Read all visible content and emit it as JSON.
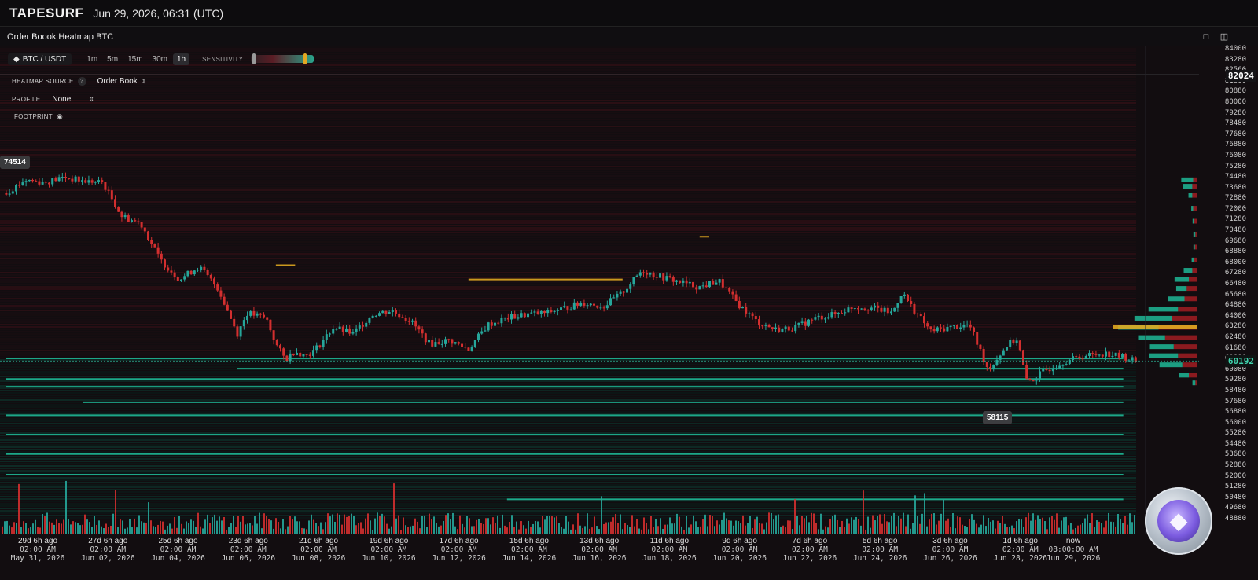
{
  "header": {
    "brand": "TAPESURF",
    "timestamp": "Jun 29, 2026, 06:31 (UTC)"
  },
  "panel": {
    "title": "Order Boook Heatmap BTC",
    "window_buttons": [
      "square-icon",
      "split-icon"
    ]
  },
  "toolbar": {
    "symbol": "BTC / USDT",
    "timeframes": [
      "1m",
      "5m",
      "15m",
      "30m",
      "1h"
    ],
    "active_timeframe": "1h",
    "sensitivity_label": "SENSITIVITY",
    "sensitivity": {
      "low": 0.02,
      "high": 0.88
    }
  },
  "options": {
    "heatmap_source_label": "HEATMAP SOURCE",
    "heatmap_source_help": "?",
    "heatmap_source_value": "Order Book",
    "profile_label": "PROFILE",
    "profile_value": "None",
    "footprint_label": "FOOTPRINT"
  },
  "markers": {
    "high": "74514",
    "low": "58115"
  },
  "colors": {
    "up": "#26a69a",
    "down": "#d32f2f",
    "bid_liquidity": "#1fb896",
    "ask_liquidity": "#8b1a1f",
    "background": "#0f0d10",
    "highlight": "#e0a820"
  },
  "chart_data": {
    "type": "candlestick",
    "title": "Order Boook Heatmap BTC",
    "interval": "1h",
    "ylim": [
      48000,
      84400
    ],
    "y_ticks": [
      "84000",
      "83280",
      "82560",
      "81600",
      "80880",
      "80000",
      "79280",
      "78480",
      "77680",
      "76880",
      "76080",
      "75280",
      "74480",
      "73680",
      "72880",
      "72000",
      "71280",
      "70480",
      "69680",
      "68880",
      "68000",
      "67280",
      "66480",
      "65680",
      "64880",
      "64000",
      "63280",
      "62480",
      "61680",
      "60880",
      "60080",
      "59280",
      "58480",
      "57680",
      "56880",
      "56000",
      "55280",
      "54480",
      "53680",
      "52880",
      "52000",
      "51280",
      "50480",
      "49680",
      "48880"
    ],
    "current_price": "60192",
    "crosshair_price": "82024",
    "x_labels": [
      {
        "rel": "29d 6h ago",
        "time": "02:00 AM",
        "date": "May 31, 2026"
      },
      {
        "rel": "27d 6h ago",
        "time": "02:00 AM",
        "date": "Jun 02, 2026"
      },
      {
        "rel": "25d 6h ago",
        "time": "02:00 AM",
        "date": "Jun 04, 2026"
      },
      {
        "rel": "23d 6h ago",
        "time": "02:00 AM",
        "date": "Jun 06, 2026"
      },
      {
        "rel": "21d 6h ago",
        "time": "02:00 AM",
        "date": "Jun 08, 2026"
      },
      {
        "rel": "19d 6h ago",
        "time": "02:00 AM",
        "date": "Jun 10, 2026"
      },
      {
        "rel": "17d 6h ago",
        "time": "02:00 AM",
        "date": "Jun 12, 2026"
      },
      {
        "rel": "15d 6h ago",
        "time": "02:00 AM",
        "date": "Jun 14, 2026"
      },
      {
        "rel": "13d 6h ago",
        "time": "02:00 AM",
        "date": "Jun 16, 2026"
      },
      {
        "rel": "11d 6h ago",
        "time": "02:00 AM",
        "date": "Jun 18, 2026"
      },
      {
        "rel": "9d 6h ago",
        "time": "02:00 AM",
        "date": "Jun 20, 2026"
      },
      {
        "rel": "7d 6h ago",
        "time": "02:00 AM",
        "date": "Jun 22, 2026"
      },
      {
        "rel": "5d 6h ago",
        "time": "02:00 AM",
        "date": "Jun 24, 2026"
      },
      {
        "rel": "3d 6h ago",
        "time": "02:00 AM",
        "date": "Jun 26, 2026"
      },
      {
        "rel": "1d 6h ago",
        "time": "02:00 AM",
        "date": "Jun 28, 2026"
      },
      {
        "rel": "now",
        "time": "08:00:00 AM",
        "date": "Jun 29, 2026"
      }
    ],
    "price_path": [
      {
        "x": "May 31, 2026",
        "y": 73200
      },
      {
        "x": "May 31, 2026 12:00",
        "y": 74200
      },
      {
        "x": "Jun 01, 2026",
        "y": 74000
      },
      {
        "x": "Jun 01, 2026 12:00",
        "y": 74400
      },
      {
        "x": "Jun 02, 2026",
        "y": 74100
      },
      {
        "x": "Jun 02, 2026 12:00",
        "y": 74000
      },
      {
        "x": "Jun 03, 2026",
        "y": 71400
      },
      {
        "x": "Jun 03, 2026 12:00",
        "y": 70800
      },
      {
        "x": "Jun 04, 2026",
        "y": 68000
      },
      {
        "x": "Jun 04, 2026 12:00",
        "y": 66500
      },
      {
        "x": "Jun 05, 2026",
        "y": 67500
      },
      {
        "x": "Jun 05, 2026 12:00",
        "y": 65800
      },
      {
        "x": "Jun 06, 2026",
        "y": 62300
      },
      {
        "x": "Jun 06, 2026 06:00",
        "y": 63900
      },
      {
        "x": "Jun 06, 2026 18:00",
        "y": 63500
      },
      {
        "x": "Jun 07, 2026",
        "y": 61500
      },
      {
        "x": "Jun 07, 2026 06:00",
        "y": 60300
      },
      {
        "x": "Jun 07, 2026 12:00",
        "y": 61000
      },
      {
        "x": "Jun 07, 2026 18:00",
        "y": 60600
      },
      {
        "x": "Jun 08, 2026",
        "y": 61000
      },
      {
        "x": "Jun 08, 2026 12:00",
        "y": 62800
      },
      {
        "x": "Jun 09, 2026",
        "y": 62300
      },
      {
        "x": "Jun 09, 2026 12:00",
        "y": 63800
      },
      {
        "x": "Jun 10, 2026",
        "y": 64100
      },
      {
        "x": "Jun 10, 2026 12:00",
        "y": 63300
      },
      {
        "x": "Jun 11, 2026",
        "y": 61500
      },
      {
        "x": "Jun 11, 2026 12:00",
        "y": 61800
      },
      {
        "x": "Jun 12, 2026",
        "y": 61100
      },
      {
        "x": "Jun 12, 2026 12:00",
        "y": 63000
      },
      {
        "x": "Jun 13, 2026",
        "y": 63500
      },
      {
        "x": "Jun 13, 2026 12:00",
        "y": 63800
      },
      {
        "x": "Jun 14, 2026",
        "y": 63900
      },
      {
        "x": "Jun 14, 2026 12:00",
        "y": 64300
      },
      {
        "x": "Jun 15, 2026",
        "y": 64700
      },
      {
        "x": "Jun 15, 2026 12:00",
        "y": 64400
      },
      {
        "x": "Jun 16, 2026",
        "y": 65500
      },
      {
        "x": "Jun 16, 2026 12:00",
        "y": 67200
      },
      {
        "x": "Jun 17, 2026",
        "y": 66700
      },
      {
        "x": "Jun 17, 2026 12:00",
        "y": 66300
      },
      {
        "x": "Jun 18, 2026",
        "y": 65900
      },
      {
        "x": "Jun 18, 2026 12:00",
        "y": 66400
      },
      {
        "x": "Jun 19, 2026",
        "y": 64600
      },
      {
        "x": "Jun 19, 2026 12:00",
        "y": 63200
      },
      {
        "x": "Jun 20, 2026",
        "y": 62600
      },
      {
        "x": "Jun 20, 2026 12:00",
        "y": 62800
      },
      {
        "x": "Jun 21, 2026",
        "y": 63500
      },
      {
        "x": "Jun 21, 2026 12:00",
        "y": 63800
      },
      {
        "x": "Jun 22, 2026",
        "y": 64400
      },
      {
        "x": "Jun 22, 2026 12:00",
        "y": 64300
      },
      {
        "x": "Jun 23, 2026",
        "y": 63900
      },
      {
        "x": "Jun 23, 2026 06:00",
        "y": 65500
      },
      {
        "x": "Jun 23, 2026 12:00",
        "y": 64400
      },
      {
        "x": "Jun 24, 2026",
        "y": 62500
      },
      {
        "x": "Jun 24, 2026 12:00",
        "y": 62800
      },
      {
        "x": "Jun 25, 2026",
        "y": 63000
      },
      {
        "x": "Jun 25, 2026 12:00",
        "y": 59500
      },
      {
        "x": "Jun 26, 2026",
        "y": 61500
      },
      {
        "x": "Jun 26, 2026 06:00",
        "y": 61900
      },
      {
        "x": "Jun 26, 2026 12:00",
        "y": 58500
      },
      {
        "x": "Jun 27, 2026",
        "y": 59500
      },
      {
        "x": "Jun 27, 2026 12:00",
        "y": 60200
      },
      {
        "x": "Jun 28, 2026",
        "y": 60600
      },
      {
        "x": "Jun 28, 2026 12:00",
        "y": 60800
      },
      {
        "x": "Jun 29, 2026",
        "y": 60500
      },
      {
        "x": "Jun 29, 2026 08:00",
        "y": 60192
      }
    ],
    "liquidity_lines": [
      {
        "price": 66500,
        "from": "Jun 12, 2026",
        "to": "Jun 16, 2026",
        "color": "#e0a820"
      },
      {
        "price": 67600,
        "from": "Jun 07, 2026",
        "to": "Jun 07, 2026 12:00",
        "color": "#e0a820"
      },
      {
        "price": 69800,
        "from": "Jun 18, 2026",
        "to": "Jun 18, 2026 06:00",
        "color": "#e0a820"
      },
      {
        "price": 60400,
        "from": "May 31, 2026",
        "to": "Jun 29, 2026",
        "color": "#1fb896"
      },
      {
        "price": 59600,
        "from": "Jun 06, 2026",
        "to": "Jun 29, 2026",
        "color": "#1fb896"
      },
      {
        "price": 58800,
        "from": "May 31, 2026",
        "to": "Jun 29, 2026",
        "color": "#1fb896"
      },
      {
        "price": 58200,
        "from": "May 31, 2026",
        "to": "Jun 29, 2026",
        "color": "#1fb896"
      },
      {
        "price": 57000,
        "from": "Jun 02, 2026",
        "to": "Jun 29, 2026",
        "color": "#1fb896"
      },
      {
        "price": 56000,
        "from": "May 31, 2026",
        "to": "Jun 29, 2026",
        "color": "#1fb896"
      },
      {
        "price": 54500,
        "from": "May 31, 2026",
        "to": "Jun 29, 2026",
        "color": "#1fb896"
      },
      {
        "price": 53000,
        "from": "May 31, 2026",
        "to": "Jun 29, 2026",
        "color": "#1fb896"
      },
      {
        "price": 51400,
        "from": "May 31, 2026",
        "to": "Jun 29, 2026",
        "color": "#1fb896"
      },
      {
        "price": 49500,
        "from": "Jun 13, 2026",
        "to": "Jun 29, 2026",
        "color": "#1fb896"
      }
    ],
    "volume_profile": [
      {
        "price": 74200,
        "bid": 0.25,
        "ask": 0.1
      },
      {
        "price": 73700,
        "bid": 0.2,
        "ask": 0.12
      },
      {
        "price": 73000,
        "bid": 0.08,
        "ask": 0.12
      },
      {
        "price": 72000,
        "bid": 0.04,
        "ask": 0.1
      },
      {
        "price": 71000,
        "bid": 0.03,
        "ask": 0.08
      },
      {
        "price": 70000,
        "bid": 0.04,
        "ask": 0.05
      },
      {
        "price": 69000,
        "bid": 0.03,
        "ask": 0.06
      },
      {
        "price": 68000,
        "bid": 0.05,
        "ask": 0.08
      },
      {
        "price": 67200,
        "bid": 0.18,
        "ask": 0.12
      },
      {
        "price": 66500,
        "bid": 0.3,
        "ask": 0.2
      },
      {
        "price": 65800,
        "bid": 0.22,
        "ask": 0.25
      },
      {
        "price": 65000,
        "bid": 0.35,
        "ask": 0.3
      },
      {
        "price": 64200,
        "bid": 0.62,
        "ask": 0.45
      },
      {
        "price": 63500,
        "bid": 0.78,
        "ask": 0.6
      },
      {
        "price": 62800,
        "bid": 0.85,
        "ask": 0.9
      },
      {
        "price": 62000,
        "bid": 0.55,
        "ask": 0.75
      },
      {
        "price": 61300,
        "bid": 0.5,
        "ask": 0.55
      },
      {
        "price": 60600,
        "bid": 0.6,
        "ask": 0.45
      },
      {
        "price": 59900,
        "bid": 0.48,
        "ask": 0.35
      },
      {
        "price": 59100,
        "bid": 0.2,
        "ask": 0.2
      },
      {
        "price": 58500,
        "bid": 0.06,
        "ask": 0.05
      }
    ]
  }
}
